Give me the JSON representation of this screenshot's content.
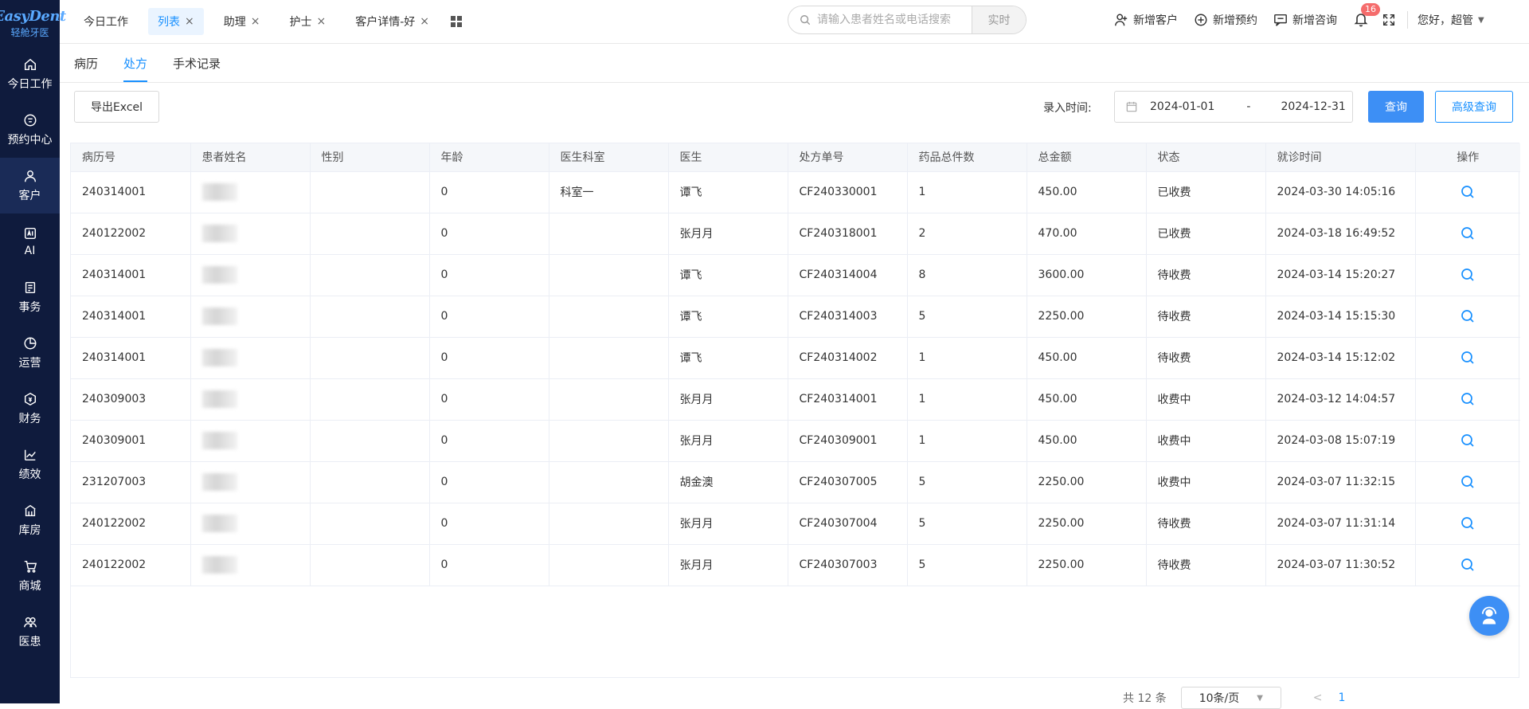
{
  "logo": {
    "main": "EasyDent",
    "sub": "轻舱牙医"
  },
  "sidebar": {
    "items": [
      {
        "label": "今日工作",
        "icon": "home-icon"
      },
      {
        "label": "预约中心",
        "icon": "calendar-icon"
      },
      {
        "label": "客户",
        "icon": "user-icon",
        "active": true
      },
      {
        "label": "AI",
        "icon": "ai-icon"
      },
      {
        "label": "事务",
        "icon": "task-icon"
      },
      {
        "label": "运营",
        "icon": "pie-chart-icon"
      },
      {
        "label": "财务",
        "icon": "finance-icon"
      },
      {
        "label": "绩效",
        "icon": "trend-icon"
      },
      {
        "label": "库房",
        "icon": "warehouse-icon"
      },
      {
        "label": "商城",
        "icon": "cart-icon"
      },
      {
        "label": "医患",
        "icon": "doctor-patient-icon"
      }
    ]
  },
  "tabs": [
    {
      "label": "今日工作",
      "closable": false,
      "active": false
    },
    {
      "label": "列表",
      "closable": true,
      "active": true
    },
    {
      "label": "助理",
      "closable": true,
      "active": false
    },
    {
      "label": "护士",
      "closable": true,
      "active": false
    },
    {
      "label": "客户详情-好",
      "closable": true,
      "active": false
    }
  ],
  "search": {
    "placeholder": "请输入患者姓名或电话搜索",
    "mode": "实时"
  },
  "header_actions": {
    "add_customer": "新增客户",
    "add_appointment": "新增预约",
    "add_consult": "新增咨询",
    "notification_count": "16",
    "greeting": "您好，超管"
  },
  "subtabs": [
    {
      "label": "病历",
      "active": false
    },
    {
      "label": "处方",
      "active": true
    },
    {
      "label": "手术记录",
      "active": false
    }
  ],
  "toolbar": {
    "export_label": "导出Excel",
    "date_label": "录入时间:",
    "date_start": "2024-01-01",
    "date_sep": "-",
    "date_end": "2024-12-31",
    "query_label": "查询",
    "advanced_label": "高级查询"
  },
  "table": {
    "columns": [
      "病历号",
      "患者姓名",
      "性别",
      "年龄",
      "医生科室",
      "医生",
      "处方单号",
      "药品总件数",
      "总金额",
      "状态",
      "就诊时间",
      "操作"
    ],
    "rows": [
      [
        "240314001",
        "",
        "",
        "0",
        "科室一",
        "谭飞",
        "CF240330001",
        "1",
        "450.00",
        "已收费",
        "2024-03-30 14:05:16"
      ],
      [
        "240122002",
        "",
        "",
        "0",
        "",
        "张月月",
        "CF240318001",
        "2",
        "470.00",
        "已收费",
        "2024-03-18 16:49:52"
      ],
      [
        "240314001",
        "",
        "",
        "0",
        "",
        "谭飞",
        "CF240314004",
        "8",
        "3600.00",
        "待收费",
        "2024-03-14 15:20:27"
      ],
      [
        "240314001",
        "",
        "",
        "0",
        "",
        "谭飞",
        "CF240314003",
        "5",
        "2250.00",
        "待收费",
        "2024-03-14 15:15:30"
      ],
      [
        "240314001",
        "",
        "",
        "0",
        "",
        "谭飞",
        "CF240314002",
        "1",
        "450.00",
        "待收费",
        "2024-03-14 15:12:02"
      ],
      [
        "240309003",
        "",
        "",
        "0",
        "",
        "张月月",
        "CF240314001",
        "1",
        "450.00",
        "收费中",
        "2024-03-12 14:04:57"
      ],
      [
        "240309001",
        "",
        "",
        "0",
        "",
        "张月月",
        "CF240309001",
        "1",
        "450.00",
        "收费中",
        "2024-03-08 15:07:19"
      ],
      [
        "231207003",
        "",
        "",
        "0",
        "",
        "胡金澳",
        "CF240307005",
        "5",
        "2250.00",
        "收费中",
        "2024-03-07 11:32:15"
      ],
      [
        "240122002",
        "",
        "",
        "0",
        "",
        "张月月",
        "CF240307004",
        "5",
        "2250.00",
        "待收费",
        "2024-03-07 11:31:14"
      ],
      [
        "240122002",
        "",
        "",
        "0",
        "",
        "张月月",
        "CF240307003",
        "5",
        "2250.00",
        "待收费",
        "2024-03-07 11:30:52"
      ]
    ]
  },
  "pagination": {
    "total": "共 12 条",
    "page_size": "10条/页",
    "current_page": "1"
  },
  "colors": {
    "primary": "#1890ff",
    "sidebar_bg": "#0f1b3d",
    "badge": "#f56c6c"
  }
}
